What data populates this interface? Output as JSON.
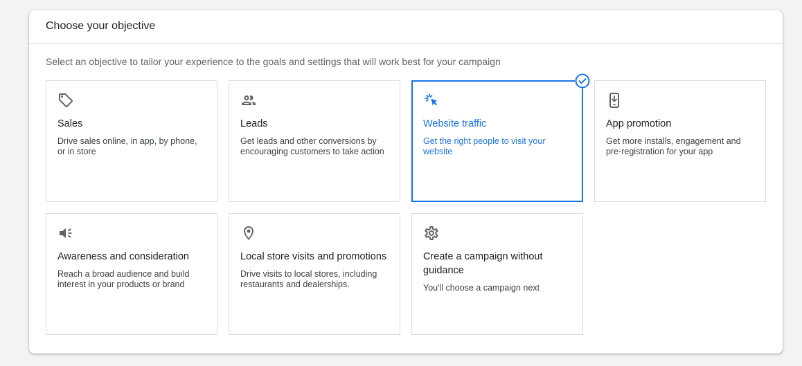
{
  "header": {
    "title": "Choose your objective"
  },
  "subtitle": "Select an objective to tailor your experience to the goals and settings that will work best for your campaign",
  "objectives": [
    {
      "title": "Sales",
      "desc": "Drive sales online, in app, by phone, or in store",
      "icon": "tag-icon",
      "selected": false
    },
    {
      "title": "Leads",
      "desc": "Get leads and other conversions by encouraging customers to take action",
      "icon": "people-icon",
      "selected": false
    },
    {
      "title": "Website traffic",
      "desc": "Get the right people to visit your website",
      "icon": "cursor-click-icon",
      "selected": true
    },
    {
      "title": "App promotion",
      "desc": "Get more installs, engagement and pre-registration for your app",
      "icon": "phone-download-icon",
      "selected": false
    },
    {
      "title": "Awareness and consideration",
      "desc": "Reach a broad audience and build interest in your products or brand",
      "icon": "megaphone-icon",
      "selected": false
    },
    {
      "title": "Local store visits and promotions",
      "desc": "Drive visits to local stores, including restaurants and dealerships.",
      "icon": "location-pin-icon",
      "selected": false
    },
    {
      "title": "Create a campaign without guidance",
      "desc": "You'll choose a campaign next",
      "icon": "gear-icon",
      "selected": false
    }
  ],
  "colors": {
    "accent": "#1a73e8",
    "border": "#dadce0",
    "icon": "#5f6368"
  }
}
